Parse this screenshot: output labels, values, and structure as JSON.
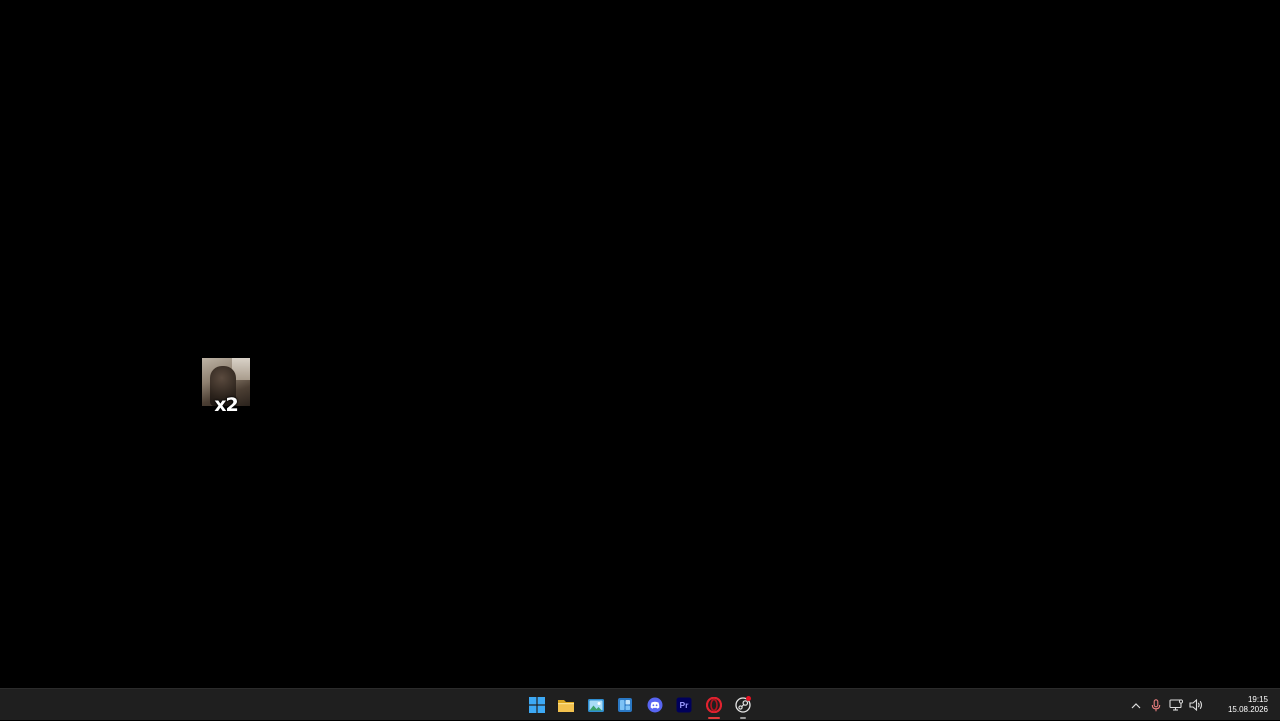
{
  "desktop": {
    "background": "#000000",
    "overlay": {
      "label": "x2",
      "image": "dark-figure-thumbnail"
    }
  },
  "taskbar": {
    "background": "#1f1f1f",
    "apps": [
      {
        "name": "Start",
        "icon": "windows-logo-icon",
        "color": "#3da9f5",
        "running": false
      },
      {
        "name": "File Explorer",
        "icon": "folder-icon",
        "color": "#f2c14e",
        "running": false
      },
      {
        "name": "Photos",
        "icon": "photos-icon",
        "color": "#4fb3e8",
        "running": false
      },
      {
        "name": "Code Editor",
        "icon": "code-editor-icon",
        "color": "#5ab0ef",
        "running": false
      },
      {
        "name": "Discord",
        "icon": "discord-icon",
        "color": "#5865f2",
        "running": false
      },
      {
        "name": "Premiere Pro",
        "icon_text": "Pr",
        "icon": "premiere-pro-icon",
        "color": "#9999ff",
        "running": false
      },
      {
        "name": "Opera",
        "icon": "opera-icon",
        "color": "#e0222f",
        "running": true,
        "active": true
      },
      {
        "name": "Steam",
        "icon": "steam-icon",
        "color": "#e6e6e6",
        "running": true,
        "notification": true
      }
    ],
    "tray": {
      "icons": [
        "chevron-up-icon",
        "microphone-icon",
        "network-icon",
        "volume-icon"
      ],
      "mic_color": "#e87d7d",
      "time": "19:15",
      "date": "15.08.2026"
    }
  }
}
